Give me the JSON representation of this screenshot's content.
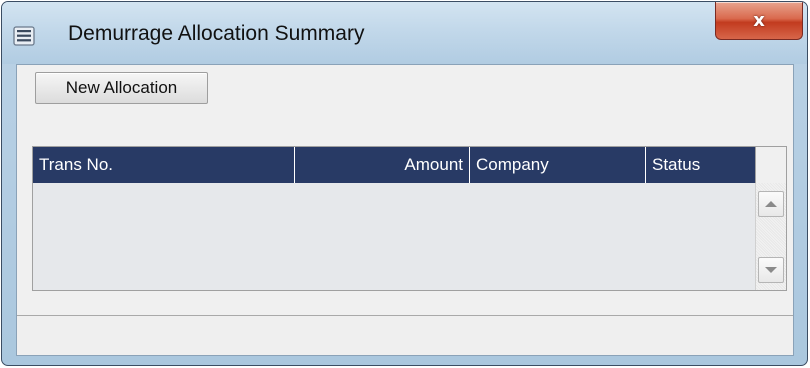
{
  "window": {
    "title": "Demurrage Allocation Summary",
    "close_label": "x",
    "title_icon": "list-icon"
  },
  "toolbar": {
    "new_allocation_label": "New Allocation"
  },
  "grid": {
    "columns": [
      "Trans No.",
      "Amount",
      "Company",
      "Status"
    ],
    "rows": []
  },
  "colors": {
    "header_bg": "#283a65",
    "header_text": "#ffffff",
    "grid_bg": "#e6e8eb",
    "close_button": "#c23b1f"
  }
}
